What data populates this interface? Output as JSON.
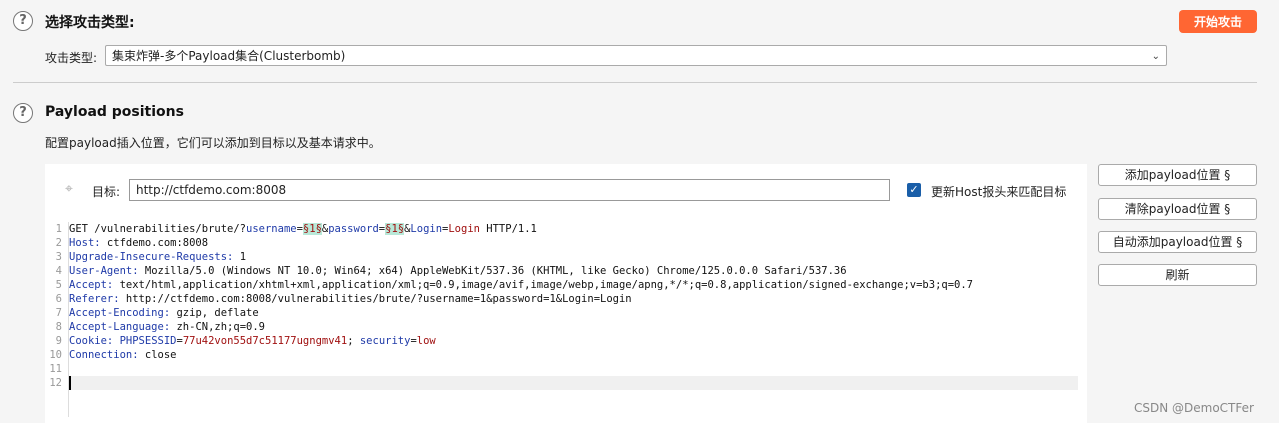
{
  "attack_type_section": {
    "help_icon": "?",
    "title": "选择攻击类型:",
    "start_button": "开始攻击",
    "attack_type_label": "攻击类型:",
    "attack_type_value": "集束炸弹-多个Payload集合(Clusterbomb)"
  },
  "payload_positions_section": {
    "help_icon": "?",
    "title": "Payload positions",
    "description": "配置payload插入位置，它们可以添加到目标以及基本请求中。",
    "target_label": "目标:",
    "target_value": "http://ctfdemo.com:8008",
    "update_host_label": "更新Host报头来匹配目标",
    "update_host_checked": true
  },
  "side_buttons": {
    "add": "添加payload位置 §",
    "clear": "清除payload位置 §",
    "auto_add": "自动添加payload位置 §",
    "refresh": "刷新"
  },
  "request_lines": [
    {
      "n": "1",
      "parts": [
        [
          "t",
          "GET /vulnerabilities/brute/?"
        ],
        [
          "k",
          "username"
        ],
        [
          "t",
          "="
        ],
        [
          "p",
          "§1§"
        ],
        [
          "t",
          "&"
        ],
        [
          "k",
          "password"
        ],
        [
          "t",
          "="
        ],
        [
          "p",
          "§1§"
        ],
        [
          "t",
          "&"
        ],
        [
          "k",
          "Login"
        ],
        [
          "t",
          "="
        ],
        [
          "v",
          "Login"
        ],
        [
          "t",
          " HTTP/1.1"
        ]
      ]
    },
    {
      "n": "2",
      "parts": [
        [
          "k",
          "Host:"
        ],
        [
          "t",
          " ctfdemo.com:8008"
        ]
      ]
    },
    {
      "n": "3",
      "parts": [
        [
          "k",
          "Upgrade-Insecure-Requests:"
        ],
        [
          "t",
          " 1"
        ]
      ]
    },
    {
      "n": "4",
      "parts": [
        [
          "k",
          "User-Agent:"
        ],
        [
          "t",
          " Mozilla/5.0 (Windows NT 10.0; Win64; x64) AppleWebKit/537.36 (KHTML, like Gecko) Chrome/125.0.0.0 Safari/537.36"
        ]
      ]
    },
    {
      "n": "5",
      "parts": [
        [
          "k",
          "Accept:"
        ],
        [
          "t",
          " text/html,application/xhtml+xml,application/xml;q=0.9,image/avif,image/webp,image/apng,*/*;q=0.8,application/signed-exchange;v=b3;q=0.7"
        ]
      ]
    },
    {
      "n": "6",
      "parts": [
        [
          "k",
          "Referer:"
        ],
        [
          "t",
          " http://ctfdemo.com:8008/vulnerabilities/brute/?username=1&password=1&Login=Login"
        ]
      ]
    },
    {
      "n": "7",
      "parts": [
        [
          "k",
          "Accept-Encoding:"
        ],
        [
          "t",
          " gzip, deflate"
        ]
      ]
    },
    {
      "n": "8",
      "parts": [
        [
          "k",
          "Accept-Language:"
        ],
        [
          "t",
          " zh-CN,zh;q=0.9"
        ]
      ]
    },
    {
      "n": "9",
      "parts": [
        [
          "k",
          "Cookie:"
        ],
        [
          "t",
          " "
        ],
        [
          "k",
          "PHPSESSID"
        ],
        [
          "t",
          "="
        ],
        [
          "v",
          "77u42von55d7c51177ugngmv41"
        ],
        [
          "t",
          "; "
        ],
        [
          "k",
          "security"
        ],
        [
          "t",
          "="
        ],
        [
          "v",
          "low"
        ]
      ]
    },
    {
      "n": "10",
      "parts": [
        [
          "k",
          "Connection:"
        ],
        [
          "t",
          " close"
        ]
      ]
    },
    {
      "n": "11",
      "parts": []
    },
    {
      "n": "12",
      "parts": []
    }
  ],
  "watermark": "CSDN @DemoCTFer"
}
